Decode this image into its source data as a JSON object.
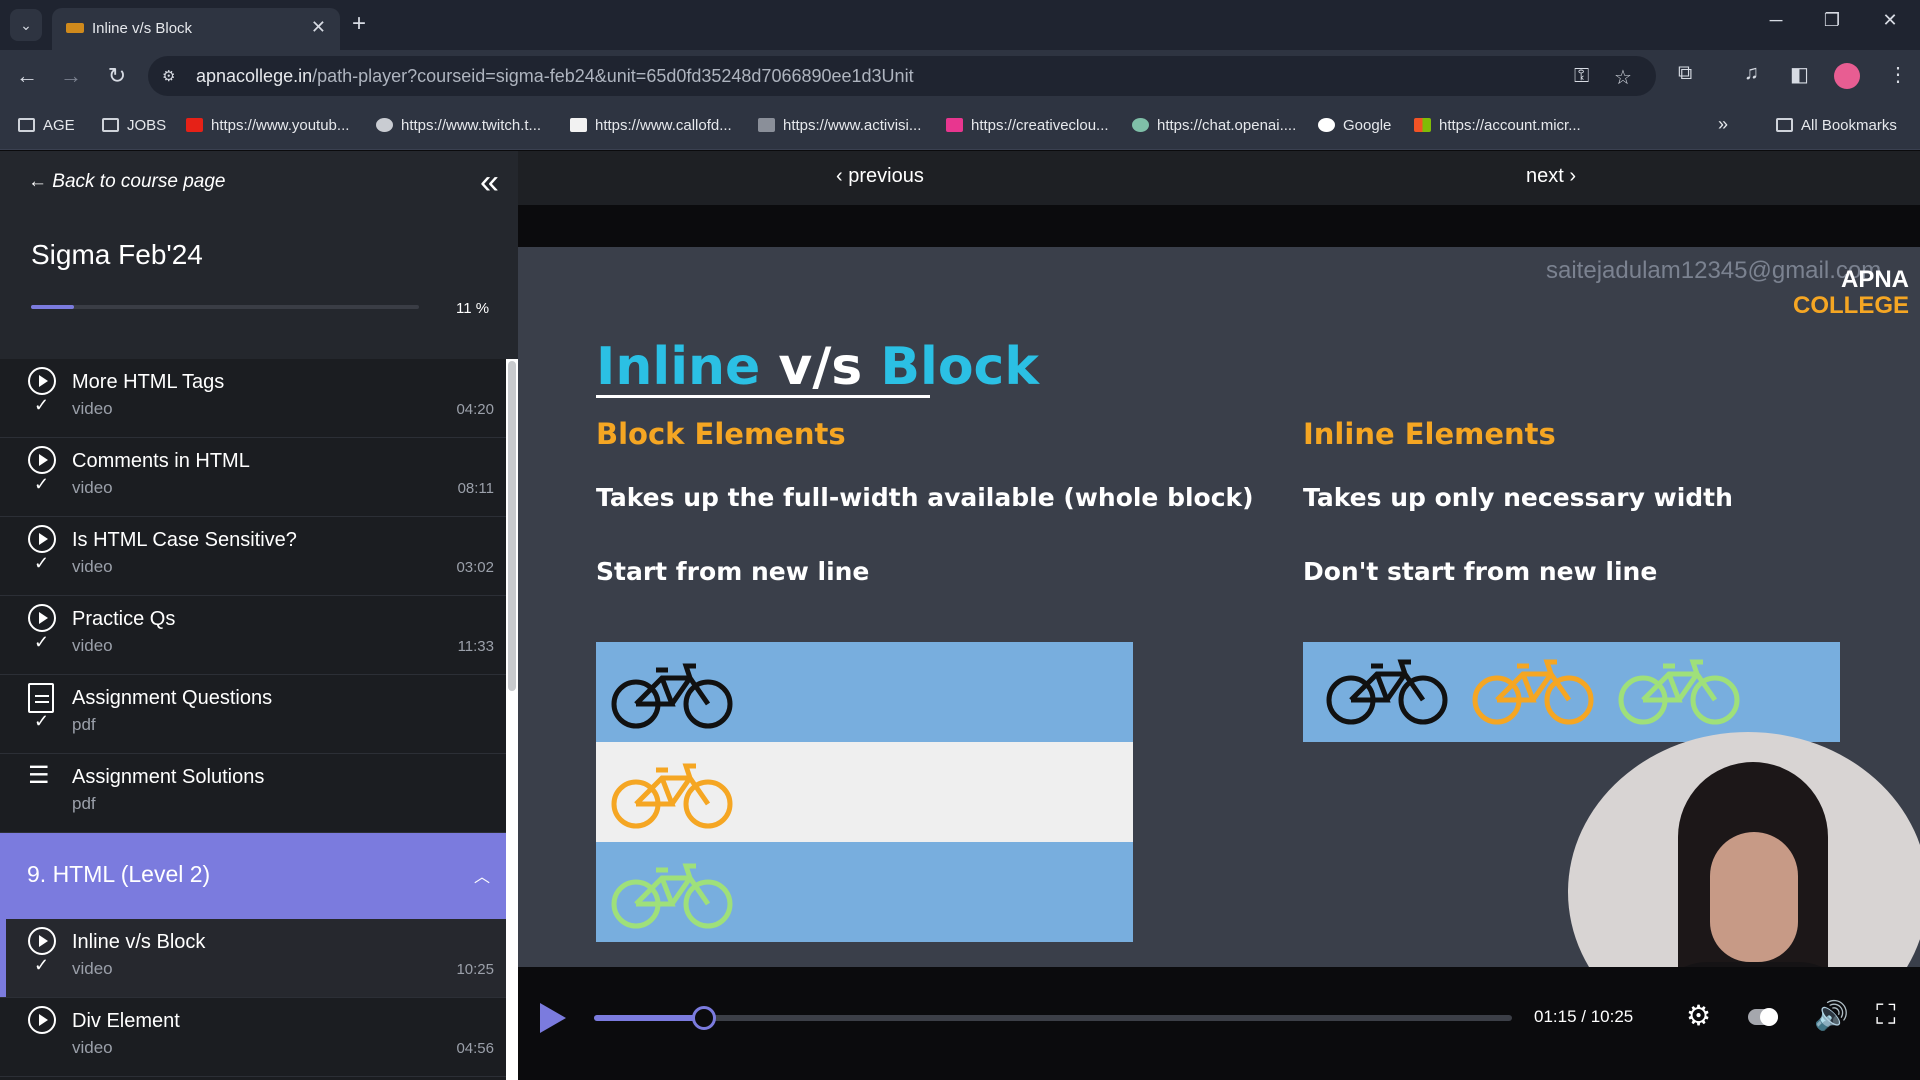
{
  "browser": {
    "tab_title": "Inline v/s Block",
    "url_host": "apnacollege.in",
    "url_path": "/path-player?courseid=sigma-feb24&unit=65d0fd35248d7066890ee1d3Unit",
    "bookmarks": [
      {
        "label": "AGE",
        "icon": "folder-icon"
      },
      {
        "label": "JOBS",
        "icon": "folder-icon"
      },
      {
        "label": "https://www.youtub...",
        "icon": "youtube-icon"
      },
      {
        "label": "https://www.twitch.t...",
        "icon": "globe-icon"
      },
      {
        "label": "https://www.callofd...",
        "icon": "callofduty-icon"
      },
      {
        "label": "https://www.activisi...",
        "icon": "activision-icon"
      },
      {
        "label": "https://creativeclou...",
        "icon": "creativecloud-icon"
      },
      {
        "label": "https://chat.openai....",
        "icon": "openai-icon"
      },
      {
        "label": "Google",
        "icon": "google-icon"
      },
      {
        "label": "https://account.micr...",
        "icon": "microsoft-icon"
      }
    ],
    "all_bookmarks": "All Bookmarks"
  },
  "sidebar": {
    "back_link": "← Back to course page",
    "course_title": "Sigma Feb'24",
    "progress_percent": 11,
    "progress_label": "11 %",
    "items": [
      {
        "name": "More HTML Tags",
        "type": "video",
        "duration": "04:20",
        "kind": "video"
      },
      {
        "name": "Comments in HTML",
        "type": "video",
        "duration": "08:11",
        "kind": "video"
      },
      {
        "name": "Is HTML Case Sensitive?",
        "type": "video",
        "duration": "03:02",
        "kind": "video"
      },
      {
        "name": "Practice Qs",
        "type": "video",
        "duration": "11:33",
        "kind": "video"
      },
      {
        "name": "Assignment Questions",
        "type": "pdf",
        "duration": "",
        "kind": "assignment"
      },
      {
        "name": "Assignment Solutions",
        "type": "pdf",
        "duration": "",
        "kind": "list"
      }
    ],
    "section": {
      "label": "9. HTML (Level 2)"
    },
    "section_items": [
      {
        "name": "Inline v/s Block",
        "type": "video",
        "duration": "10:25",
        "active": true
      },
      {
        "name": "Div Element",
        "type": "video",
        "duration": "04:56",
        "active": false
      }
    ]
  },
  "player": {
    "previous": "previous",
    "next": "next",
    "watermark": "saitejadulam12345@gmail.com",
    "brand_line1": "APNA",
    "brand_line2": "COLLEGE",
    "slide": {
      "title_1": "Inline",
      "title_2": " v/s ",
      "title_3": "Block",
      "block_heading": "Block Elements",
      "block_text_1": "Takes up the full-width available (whole block)",
      "block_text_2": "Start from new line",
      "inline_heading": "Inline Elements",
      "inline_text_1": "Takes up only necessary width",
      "inline_text_2": "Don't start from new line"
    },
    "time": "01:15 / 10:25",
    "progress_fraction": 0.12,
    "colors": {
      "accent": "#7b7bde",
      "slide_blue": "#2bc0e4",
      "slide_orange": "#f5a623"
    }
  }
}
